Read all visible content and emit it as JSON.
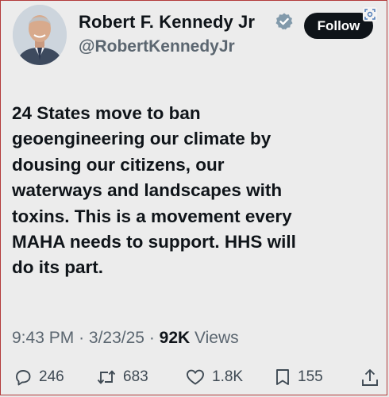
{
  "author": {
    "name": "Robert F. Kennedy Jr",
    "handle": "@RobertKennedyJr",
    "verified_color": "#829aab"
  },
  "follow_label": "Follow",
  "tweet_text": "24 States move to ban\ngeoengineering our climate by\ndousing our citizens, our\nwaterways and landscapes with\ntoxins. This is a movement every\nMAHA needs to support. HHS will\ndo its part.",
  "meta": {
    "time": "9:43 PM",
    "date": "3/23/25",
    "views_count": "92K",
    "views_label": "Views"
  },
  "actions": {
    "replies": "246",
    "reposts": "683",
    "likes": "1.8K",
    "bookmarks": "155"
  },
  "icons": {
    "reply": "reply-icon",
    "repost": "repost-icon",
    "like": "heart-icon",
    "bookmark": "bookmark-icon",
    "share": "share-icon",
    "verified": "verified-badge-icon",
    "lens": "visual-search-icon"
  }
}
